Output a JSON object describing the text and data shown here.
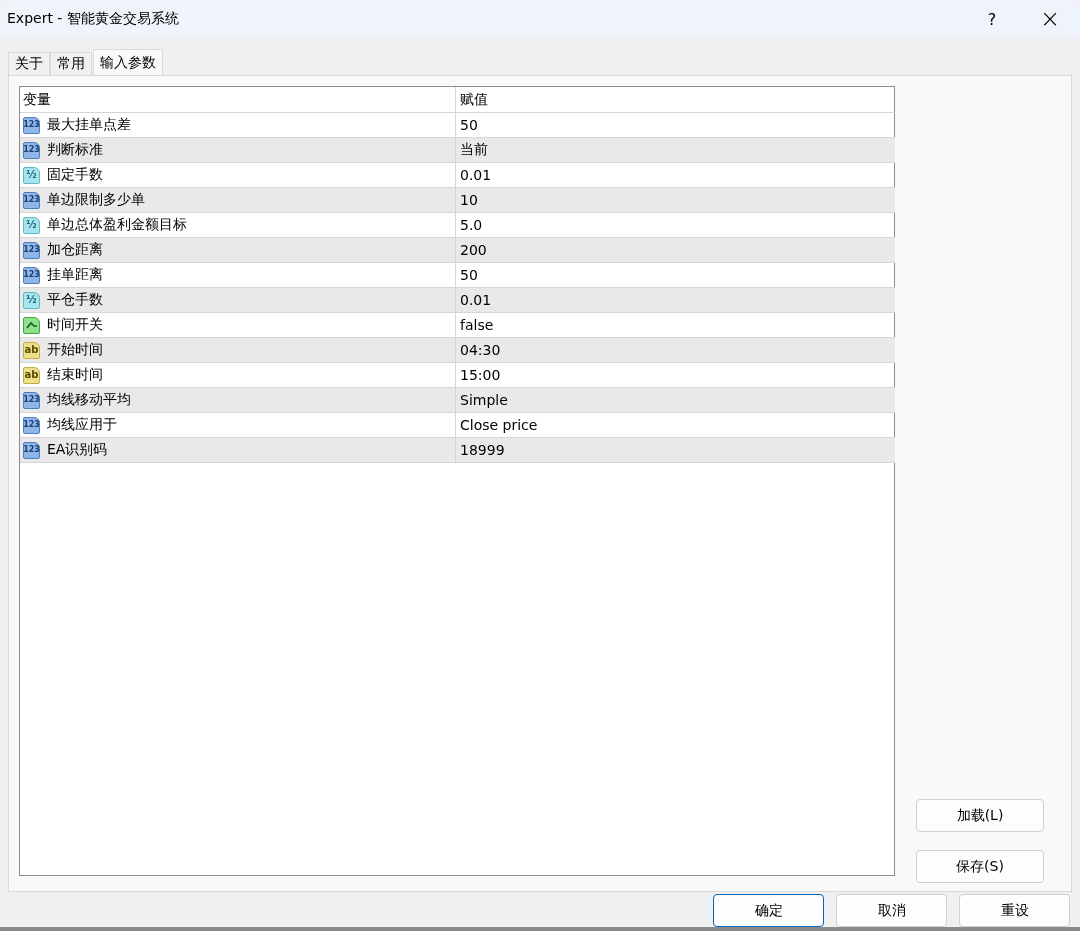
{
  "window": {
    "title": "Expert - 智能黄金交易系统",
    "help": "?",
    "close": "×"
  },
  "tabs": [
    {
      "label": "关于",
      "selected": false
    },
    {
      "label": "常用",
      "selected": false
    },
    {
      "label": "输入参数",
      "selected": true
    }
  ],
  "table": {
    "columns": [
      "变量",
      "赋值"
    ],
    "rows": [
      {
        "kind": "int",
        "icon": "123",
        "name": "最大挂单点差",
        "value": "50"
      },
      {
        "kind": "int",
        "icon": "123",
        "name": "判断标准",
        "value": "当前"
      },
      {
        "kind": "double",
        "icon": "½",
        "name": "固定手数",
        "value": "0.01"
      },
      {
        "kind": "int",
        "icon": "123",
        "name": "单边限制多少单",
        "value": "10"
      },
      {
        "kind": "double",
        "icon": "½",
        "name": "单边总体盈利金额目标",
        "value": "5.0"
      },
      {
        "kind": "int",
        "icon": "123",
        "name": "加仓距离",
        "value": "200"
      },
      {
        "kind": "int",
        "icon": "123",
        "name": "挂单距离",
        "value": "50"
      },
      {
        "kind": "double",
        "icon": "½",
        "name": "平仓手数",
        "value": "0.01"
      },
      {
        "kind": "bool",
        "name": "时间开关",
        "value": "false"
      },
      {
        "kind": "string",
        "icon": "ab",
        "name": "开始时间",
        "value": "04:30"
      },
      {
        "kind": "string",
        "icon": "ab",
        "name": "结束时间",
        "value": "15:00"
      },
      {
        "kind": "int",
        "icon": "123",
        "name": "均线移动平均",
        "value": "Simple"
      },
      {
        "kind": "int",
        "icon": "123",
        "name": "均线应用于",
        "value": "Close price"
      },
      {
        "kind": "int",
        "icon": "123",
        "name": "EA识别码",
        "value": "18999"
      }
    ]
  },
  "side_buttons": [
    "加载(L)",
    "保存(S)"
  ],
  "buttons": [
    {
      "label": "确定",
      "selected": true
    },
    {
      "label": "取消",
      "selected": false
    },
    {
      "label": "重设",
      "selected": false
    }
  ]
}
